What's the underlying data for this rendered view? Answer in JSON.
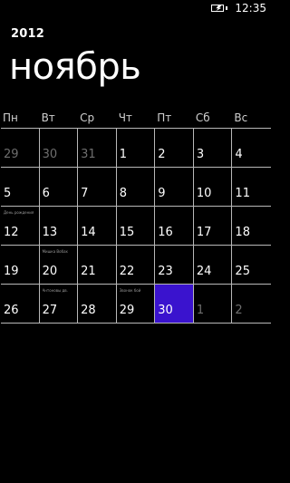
{
  "status": {
    "time": "12:35",
    "battery_icon": "battery-charging-icon"
  },
  "header": {
    "year": "2012",
    "month": "ноябрь"
  },
  "weekdays": [
    "Пн",
    "Вт",
    "Ср",
    "Чт",
    "Пт",
    "Сб",
    "Вс"
  ],
  "weeks": [
    [
      {
        "day": "29",
        "muted": true
      },
      {
        "day": "30",
        "muted": true
      },
      {
        "day": "31",
        "muted": true
      },
      {
        "day": "1"
      },
      {
        "day": "2"
      },
      {
        "day": "3"
      },
      {
        "day": "4"
      }
    ],
    [
      {
        "day": "5"
      },
      {
        "day": "6"
      },
      {
        "day": "7"
      },
      {
        "day": "8"
      },
      {
        "day": "9"
      },
      {
        "day": "10"
      },
      {
        "day": "11"
      }
    ],
    [
      {
        "day": "12",
        "event": "День рождения"
      },
      {
        "day": "13"
      },
      {
        "day": "14"
      },
      {
        "day": "15"
      },
      {
        "day": "16"
      },
      {
        "day": "17"
      },
      {
        "day": "18"
      }
    ],
    [
      {
        "day": "19"
      },
      {
        "day": "20",
        "event": "Мишка Вобах"
      },
      {
        "day": "21"
      },
      {
        "day": "22"
      },
      {
        "day": "23"
      },
      {
        "day": "24"
      },
      {
        "day": "25"
      }
    ],
    [
      {
        "day": "26"
      },
      {
        "day": "27",
        "event": "Антоновы дв."
      },
      {
        "day": "28"
      },
      {
        "day": "29",
        "event": "Звонок бой"
      },
      {
        "day": "30",
        "today": true
      },
      {
        "day": "1",
        "muted": true
      },
      {
        "day": "2",
        "muted": true
      }
    ]
  ],
  "colors": {
    "background": "#000000",
    "text": "#ffffff",
    "muted": "#6e6e6e",
    "grid_line": "#b8b8b8",
    "today_highlight": "#3a13ce"
  }
}
